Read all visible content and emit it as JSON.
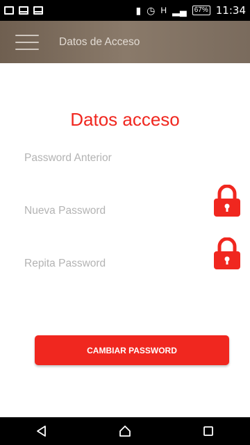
{
  "status_bar": {
    "network_type": "H",
    "battery": "67%",
    "time": "11:34"
  },
  "app_bar": {
    "title": "Datos de Acceso"
  },
  "form": {
    "title": "Datos acceso",
    "fields": [
      {
        "placeholder": "Password Anterior",
        "icon": null
      },
      {
        "placeholder": "Nueva Password",
        "icon": "lock-icon"
      },
      {
        "placeholder": "Repita Password",
        "icon": "lock-icon"
      }
    ],
    "submit_label": "CAMBIAR PASSWORD"
  },
  "colors": {
    "accent": "#f0271f",
    "app_bar": "#7a6b5d",
    "placeholder": "#b3b3b3"
  }
}
